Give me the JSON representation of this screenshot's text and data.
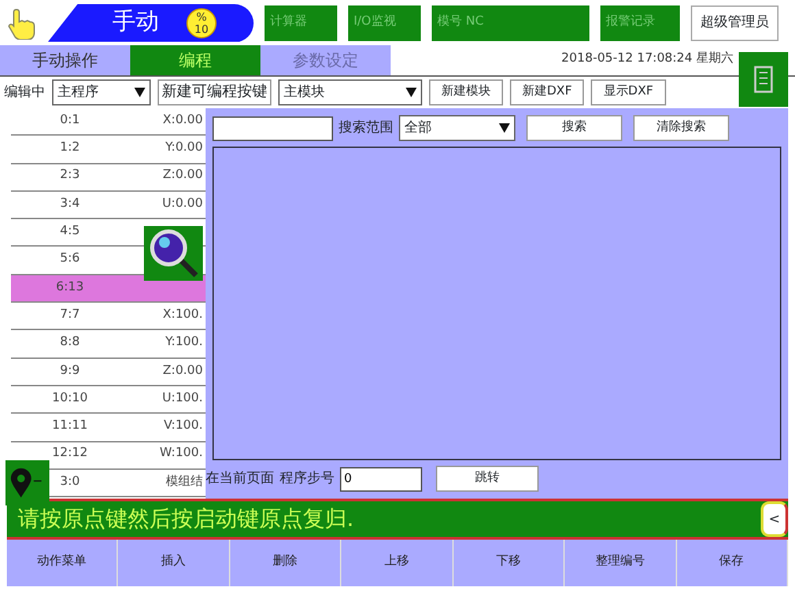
{
  "header": {
    "mode": "手动",
    "speed_badge": {
      "symbol": "%",
      "value": "10"
    },
    "indicators": [
      "计算器",
      "I/O监视",
      "模号 NC",
      "报警记录"
    ],
    "user_button": "超级管理员"
  },
  "tabs": [
    {
      "label": "手动操作",
      "selected": false,
      "disabled": false
    },
    {
      "label": "编程",
      "selected": true,
      "disabled": false
    },
    {
      "label": "参数设定",
      "selected": false,
      "disabled": true
    }
  ],
  "datetime": {
    "date": "2018-05-12",
    "time": "17:08:24",
    "weekday": "星期六"
  },
  "toolbar": {
    "editing_label": "编辑中",
    "program_select": "主程序",
    "new_key_button": "新建可编程按键",
    "module_select": "主模块",
    "buttons": [
      "新建模块",
      "新建DXF",
      "显示DXF"
    ]
  },
  "steps": [
    {
      "step": "0:1",
      "value": "X:0.00",
      "selected": false
    },
    {
      "step": "1:2",
      "value": "Y:0.00",
      "selected": false
    },
    {
      "step": "2:3",
      "value": "Z:0.00",
      "selected": false
    },
    {
      "step": "3:4",
      "value": "U:0.00",
      "selected": false
    },
    {
      "step": "4:5",
      "selected": false
    },
    {
      "step": "5:6",
      "selected": false
    },
    {
      "step": "6:13",
      "selected": true
    },
    {
      "step": "7:7",
      "value": "X:100.",
      "selected": false
    },
    {
      "step": "8:8",
      "value": "Y:100.",
      "selected": false
    },
    {
      "step": "9:9",
      "value": "Z:0.00",
      "selected": false
    },
    {
      "step": "10:10",
      "value": "U:100.",
      "selected": false
    },
    {
      "step": "11:11",
      "value": "V:100.",
      "selected": false
    },
    {
      "step": "12:12",
      "value": "W:100.",
      "selected": false
    },
    {
      "step": "3:0",
      "value": "模组结",
      "selected": false
    }
  ],
  "search": {
    "range_label": "搜索范围",
    "range_select": "全部",
    "search_button": "搜索",
    "clear_button": "清除搜索"
  },
  "jump": {
    "page_label": "在当前页面",
    "step_label": "程序步号",
    "step_value": "0",
    "jump_button": "跳转"
  },
  "status_message": "请按原点键然后按启动键原点复归.",
  "collapse_button": "<",
  "bottom_buttons": [
    "动作菜单",
    "插入",
    "删除",
    "上移",
    "下移",
    "整理编号",
    "保存"
  ]
}
